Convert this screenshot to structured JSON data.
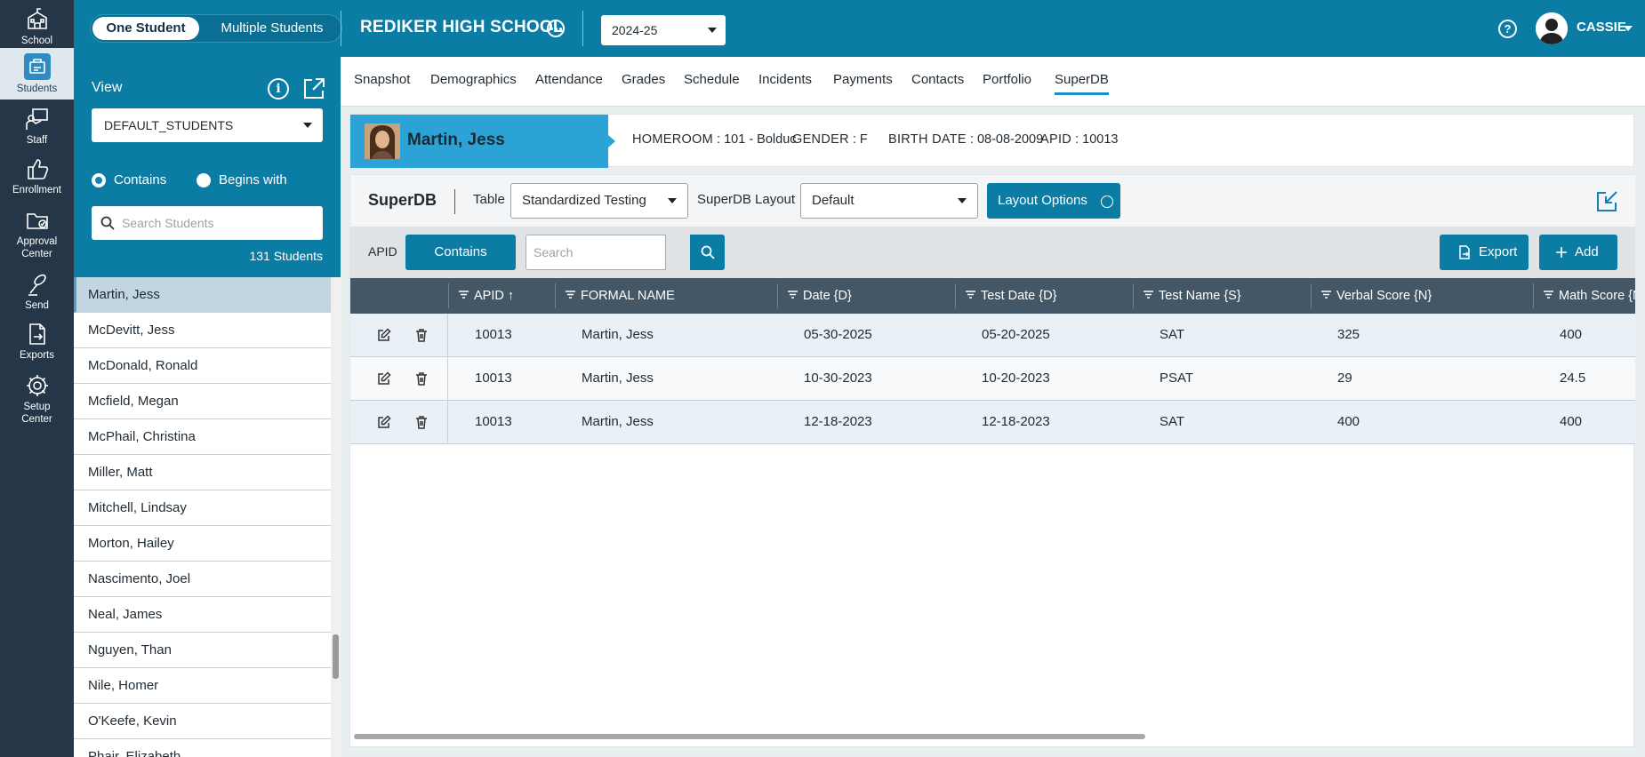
{
  "rail": [
    {
      "label": "School",
      "icon": "school-icon"
    },
    {
      "label": "Students",
      "icon": "students-icon"
    },
    {
      "label": "Staff",
      "icon": "staff-icon"
    },
    {
      "label": "Enrollment",
      "icon": "enrollment-icon"
    },
    {
      "label": "Approval Center",
      "icon": "approval-center-icon"
    },
    {
      "label": "Send",
      "icon": "send-icon"
    },
    {
      "label": "Exports",
      "icon": "exports-icon"
    },
    {
      "label": "Setup Center",
      "icon": "setup-center-icon"
    }
  ],
  "header": {
    "toggle_one": "One Student",
    "toggle_multiple": "Multiple Students",
    "school_name": "REDIKER HIGH SCHOOL",
    "year": "2024-25",
    "user": "CASSIE",
    "help": "?"
  },
  "sidebar": {
    "view_label": "View",
    "view_value": "DEFAULT_STUDENTS",
    "radio_contains": "Contains",
    "radio_begins": "Begins with",
    "search_placeholder": "Search Students",
    "count": "131 Students",
    "students": [
      "Martin, Jess",
      "McDevitt, Jess",
      "McDonald, Ronald",
      "Mcfield, Megan",
      "McPhail, Christina",
      "Miller, Matt",
      "Mitchell, Lindsay",
      "Morton, Hailey",
      "Nascimento, Joel",
      "Neal, James",
      "Nguyen, Than",
      "Nile, Homer",
      "O'Keefe, Kevin",
      "Phair, Elizabeth"
    ]
  },
  "tabs": [
    "Snapshot",
    "Demographics",
    "Attendance",
    "Grades",
    "Schedule",
    "Incidents",
    "Payments",
    "Contacts",
    "Portfolio",
    "SuperDB"
  ],
  "banner": {
    "name": "Martin, Jess",
    "homeroom_label": "HOMEROOM",
    "homeroom_value": ": 101 - Bolduc",
    "gender_label": "GENDER",
    "gender_value": ": F",
    "birth_label": "BIRTH DATE",
    "birth_value": ": 08-08-2009",
    "apid_label": "APID",
    "apid_value": ": 10013"
  },
  "superdb": {
    "title": "SuperDB",
    "table_label": "Table",
    "table_value": "Standardized Testing",
    "layout_label": "SuperDB Layout",
    "layout_value": "Default",
    "layout_options": "Layout Options",
    "filter_field": "APID",
    "filter_mode": "Contains",
    "search_placeholder": "Search",
    "export_label": "Export",
    "add_label": "Add",
    "columns": [
      "APID ↑",
      "FORMAL NAME",
      "Date {D}",
      "Test Date {D}",
      "Test Name {S}",
      "Verbal Score {N}",
      "Math Score {N}"
    ],
    "rows": [
      [
        "10013",
        "Martin, Jess",
        "05-30-2025",
        "05-20-2025",
        "SAT",
        "325",
        "400"
      ],
      [
        "10013",
        "Martin, Jess",
        "10-30-2023",
        "10-20-2023",
        "PSAT",
        "29",
        "24.5"
      ],
      [
        "10013",
        "Martin, Jess",
        "12-18-2023",
        "12-18-2023",
        "SAT",
        "400",
        "400"
      ]
    ]
  }
}
